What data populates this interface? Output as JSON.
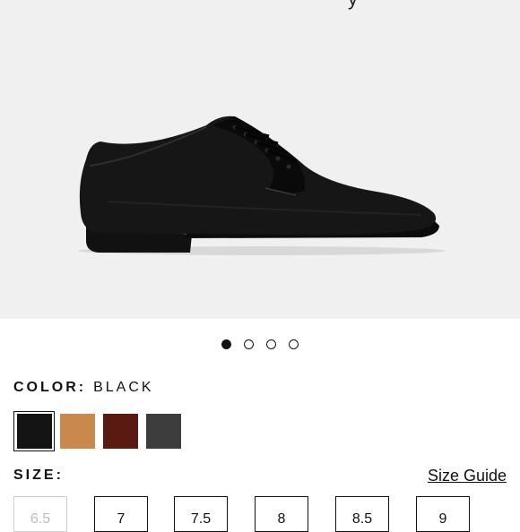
{
  "product": {
    "hero_partial_text": "y",
    "image_alt": "black leather oxford shoe"
  },
  "gallery": {
    "dots": [
      {
        "active": true
      },
      {
        "active": false
      },
      {
        "active": false
      },
      {
        "active": false
      }
    ]
  },
  "color": {
    "label": "COLOR:",
    "selected": "BLACK",
    "swatches": [
      {
        "name": "black",
        "hex": "#141414"
      },
      {
        "name": "tan",
        "hex": "#c9884c"
      },
      {
        "name": "burgundy",
        "hex": "#5a1a12"
      },
      {
        "name": "dark-grey",
        "hex": "#3d3d3d"
      }
    ]
  },
  "size": {
    "label": "SIZE:",
    "guide_label": "Size Guide",
    "options": [
      {
        "label": "6.5",
        "available": false
      },
      {
        "label": "7",
        "available": true
      },
      {
        "label": "7.5",
        "available": true
      },
      {
        "label": "8",
        "available": true
      },
      {
        "label": "8.5",
        "available": true
      },
      {
        "label": "9",
        "available": true
      }
    ]
  }
}
